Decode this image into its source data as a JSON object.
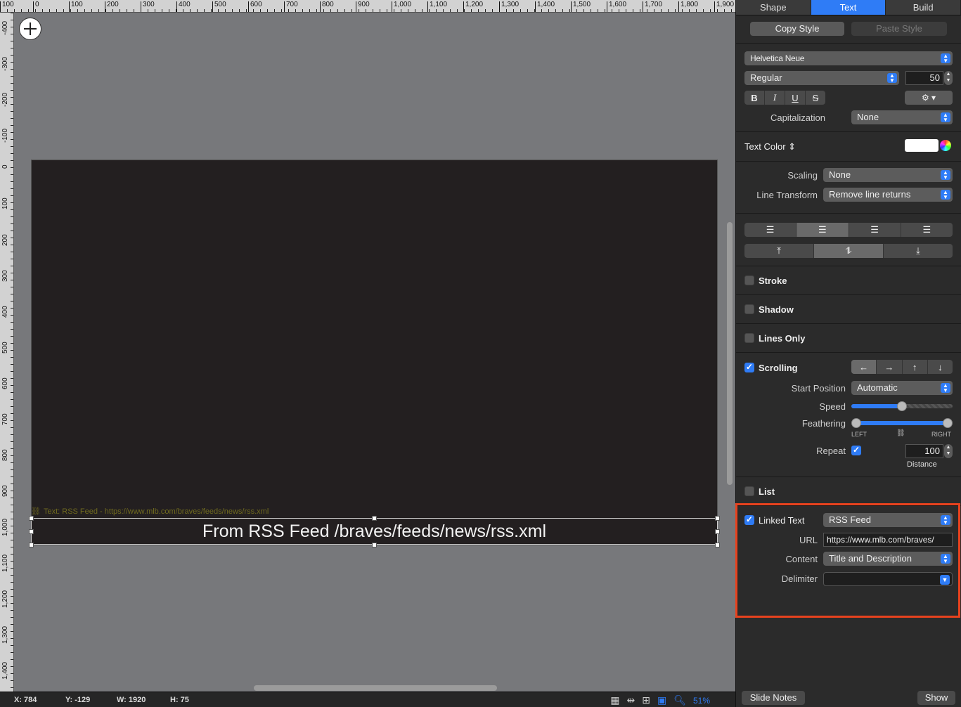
{
  "ruler": {
    "top_labels": [
      "100",
      "0",
      "100",
      "200",
      "300",
      "400",
      "500",
      "600",
      "700",
      "800",
      "900",
      "1,000",
      "1,100",
      "1,200",
      "1,300",
      "1,400",
      "1,500",
      "1,600",
      "1,700",
      "1,800",
      "1,900"
    ],
    "left_labels": [
      "-400",
      "-300",
      "-200",
      "-100",
      "0",
      "100",
      "200",
      "300",
      "400",
      "500",
      "600",
      "700",
      "800",
      "900",
      "1,000",
      "1,100",
      "1,200",
      "1,300",
      "1,400"
    ]
  },
  "canvas": {
    "link_hint": "Text: RSS Feed - https://www.mlb.com/braves/feeds/news/rss.xml",
    "text_content": "From RSS Feed /braves/feeds/news/rss.xml"
  },
  "status": {
    "x": "X: 784",
    "y": "Y: -129",
    "w": "W: 1920",
    "h": "H: 75",
    "zoom": "51%"
  },
  "tabs": [
    "Shape",
    "Text",
    "Build"
  ],
  "style_buttons": {
    "copy": "Copy Style",
    "paste": "Paste Style"
  },
  "font": {
    "family": "Helvetica Neue",
    "weight": "Regular",
    "size": "50",
    "format_buttons": [
      "B",
      "I",
      "U",
      "S"
    ],
    "capitalization_label": "Capitalization",
    "capitalization_value": "None"
  },
  "text_color": {
    "label": "Text Color",
    "value": "#ffffff"
  },
  "scaling": {
    "label": "Scaling",
    "value": "None"
  },
  "line_transform": {
    "label": "Line Transform",
    "value": "Remove line returns"
  },
  "stroke": {
    "label": "Stroke",
    "checked": false
  },
  "shadow": {
    "label": "Shadow",
    "checked": false
  },
  "lines_only": {
    "label": "Lines Only",
    "checked": false
  },
  "scrolling": {
    "label": "Scrolling",
    "checked": true,
    "start_position_label": "Start Position",
    "start_position_value": "Automatic",
    "speed_label": "Speed",
    "speed_value": 0.5,
    "feathering_label": "Feathering",
    "feathering_left": "LEFT",
    "feathering_right": "RIGHT",
    "repeat_label": "Repeat",
    "distance_value": "100",
    "distance_label": "Distance"
  },
  "list": {
    "label": "List",
    "checked": false
  },
  "linked_text": {
    "label": "Linked Text",
    "checked": true,
    "source": "RSS Feed",
    "url_label": "URL",
    "url_value": "https://www.mlb.com/braves/",
    "content_label": "Content",
    "content_value": "Title and Description",
    "delimiter_label": "Delimiter",
    "delimiter_value": ""
  },
  "footer": {
    "slide_notes": "Slide Notes",
    "show": "Show"
  },
  "colors": {
    "accent": "#2f7cf6",
    "highlight": "#e8421e"
  }
}
